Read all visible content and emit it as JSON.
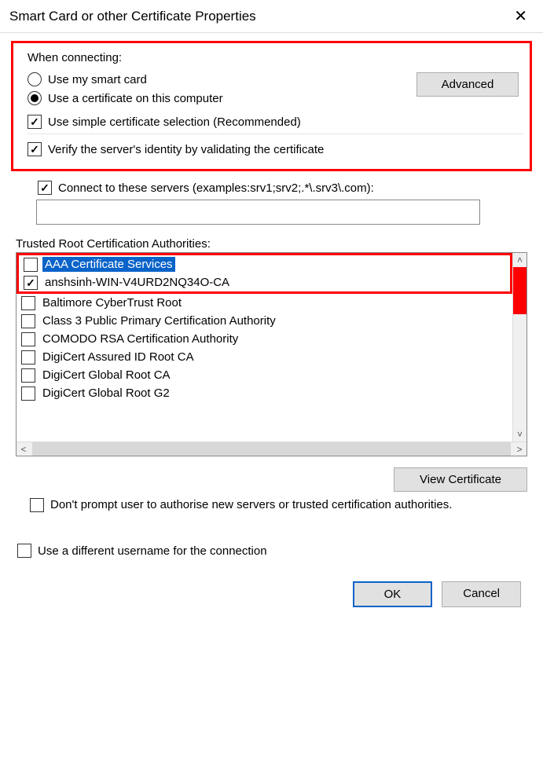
{
  "title": "Smart Card or other Certificate Properties",
  "section_when_connecting": "When connecting:",
  "radio_smartcard": "Use my smart card",
  "radio_computer": "Use a certificate on this computer",
  "chk_simple": "Use simple certificate selection (Recommended)",
  "btn_advanced": "Advanced",
  "chk_verify": "Verify the server's identity by validating the certificate",
  "chk_connect_servers": "Connect to these servers (examples:srv1;srv2;.*\\.srv3\\.com):",
  "servers_value": "",
  "trca_label": "Trusted Root Certification Authorities:",
  "ca_list": [
    {
      "label": "AAA Certificate Services",
      "checked": false,
      "selected": true
    },
    {
      "label": "anshsinh-WIN-V4URD2NQ34O-CA",
      "checked": true,
      "selected": false
    },
    {
      "label": "Baltimore CyberTrust Root",
      "checked": false,
      "selected": false
    },
    {
      "label": "Class 3 Public Primary Certification Authority",
      "checked": false,
      "selected": false
    },
    {
      "label": "COMODO RSA Certification Authority",
      "checked": false,
      "selected": false
    },
    {
      "label": "DigiCert Assured ID Root CA",
      "checked": false,
      "selected": false
    },
    {
      "label": "DigiCert Global Root CA",
      "checked": false,
      "selected": false
    },
    {
      "label": "DigiCert Global Root G2",
      "checked": false,
      "selected": false
    }
  ],
  "btn_view_cert": "View Certificate",
  "chk_dont_prompt": "Don't prompt user to authorise new servers or trusted certification authorities.",
  "chk_diff_user": "Use a different username for the connection",
  "btn_ok": "OK",
  "btn_cancel": "Cancel"
}
